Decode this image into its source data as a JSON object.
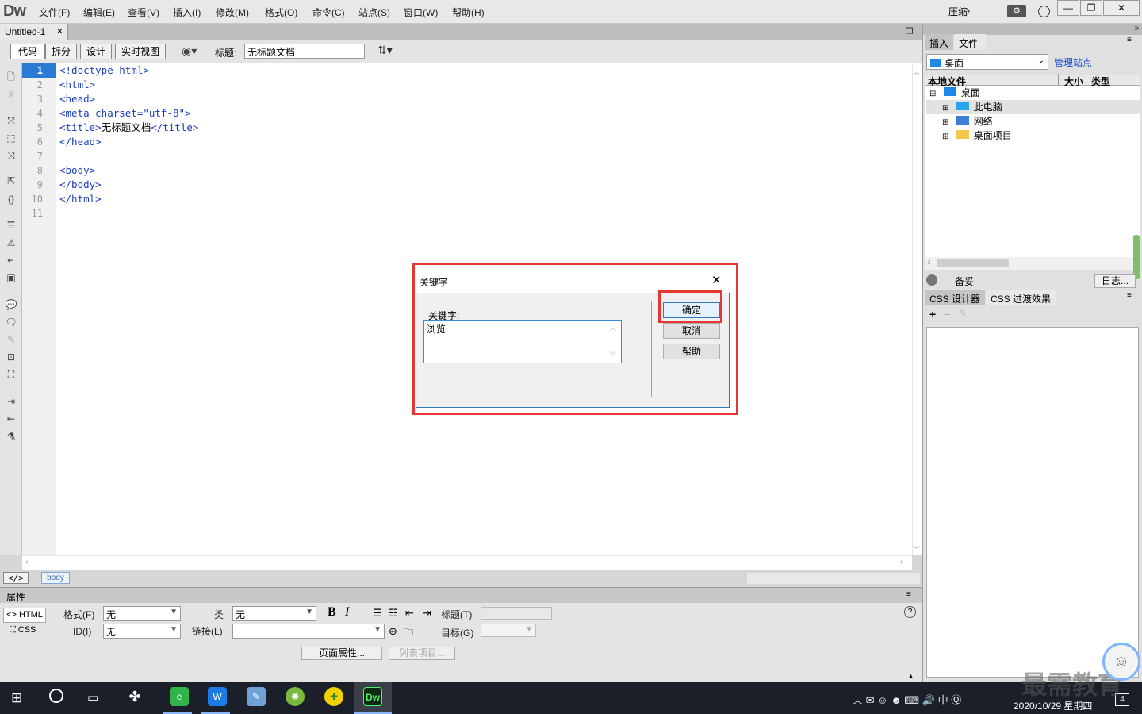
{
  "app": {
    "logo": "Dw"
  },
  "menu": [
    "文件(F)",
    "编辑(E)",
    "查看(V)",
    "插入(I)",
    "修改(M)",
    "格式(O)",
    "命令(C)",
    "站点(S)",
    "窗口(W)",
    "帮助(H)"
  ],
  "titlebar": {
    "compress_label": "压缩",
    "minimize": "—",
    "restore": "❐",
    "close": "✕"
  },
  "document_tab": {
    "name": "Untitled-1",
    "close": "✕"
  },
  "toolbar": {
    "code": "代码",
    "split": "拆分",
    "design": "设计",
    "live": "实时视图",
    "title_label": "标题:",
    "title_value": "无标题文档"
  },
  "code_lines": [
    {
      "num": "1",
      "text": "<!doctype html>"
    },
    {
      "num": "2",
      "text": "<html>"
    },
    {
      "num": "3",
      "text": "<head>"
    },
    {
      "num": "4",
      "text": "<meta charset=\"utf-8\">"
    },
    {
      "num": "5",
      "text": "<title>无标题文档</title>"
    },
    {
      "num": "6",
      "text": "</head>"
    },
    {
      "num": "7",
      "text": ""
    },
    {
      "num": "8",
      "text": "<body>"
    },
    {
      "num": "9",
      "text": "</body>"
    },
    {
      "num": "10",
      "text": "</html>"
    },
    {
      "num": "11",
      "text": ""
    }
  ],
  "status": {
    "tag": "body"
  },
  "properties": {
    "header": "属性",
    "html_btn": "HTML",
    "css_btn": "CSS",
    "format_label": "格式(F)",
    "format_value": "无",
    "class_label": "类",
    "class_value": "无",
    "title_label": "标题(T)",
    "id_label": "ID(I)",
    "id_value": "无",
    "link_label": "链接(L)",
    "target_label": "目标(G)",
    "page_props": "页面属性...",
    "list_item": "列表项目..."
  },
  "right_panel": {
    "tabs": [
      "插入",
      "文件"
    ],
    "location": "桌面",
    "manage_sites": "管理站点",
    "col_local": "本地文件",
    "col_size": "大小",
    "col_type": "类型",
    "tree": [
      "桌面",
      "此电脑",
      "网络",
      "桌面项目"
    ],
    "log_label": "备妥",
    "log_btn": "日志...",
    "css_tabs": [
      "CSS 设计器",
      "CSS 过渡效果"
    ]
  },
  "dialog": {
    "title": "关键字",
    "close": "✕",
    "field_label": "关键字:",
    "field_value": "浏览",
    "ok": "确定",
    "cancel": "取消",
    "help": "帮助"
  },
  "taskbar": {
    "ime": "中",
    "datetime": "2020/10/29 星期四",
    "notifications": "4"
  },
  "watermark": "最需教育",
  "colors": {
    "accent": "#2b78c5",
    "highlight": "#e53535",
    "code": "#1a3cba"
  }
}
